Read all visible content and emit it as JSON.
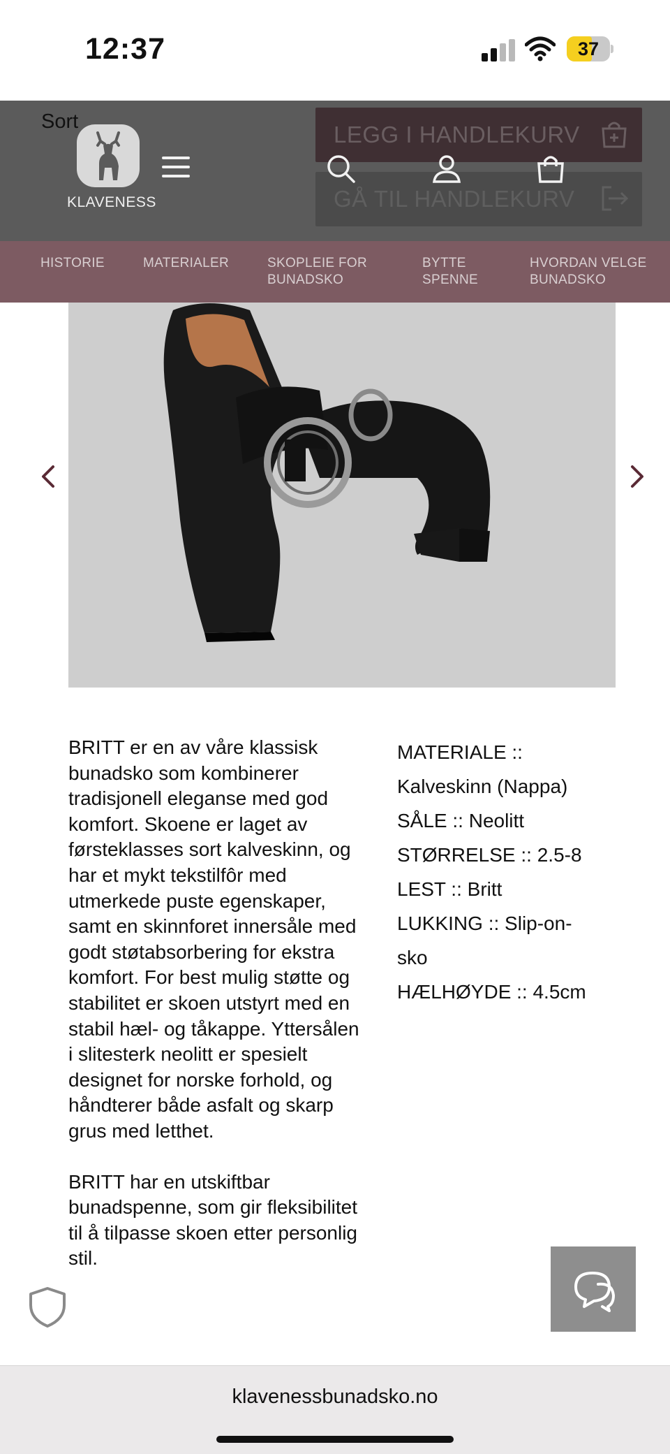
{
  "status_bar": {
    "time": "12:37",
    "battery_level": "37",
    "battery_color": "#f5cf1f"
  },
  "header": {
    "color_label": "Sort",
    "brand": "KLAVENESS",
    "add_to_cart_label": "LEGG I HANDLEKURV",
    "go_to_cart_label": "GÅ TIL HANDLEKURV",
    "icons": [
      "deer-logo-icon",
      "menu-icon",
      "search-icon",
      "user-icon",
      "shopping-bag-icon",
      "cart-add-icon",
      "logout-arrow-icon"
    ],
    "background_color": "#5b5b5b"
  },
  "nav": {
    "items": [
      {
        "label": "HISTORIE"
      },
      {
        "label": "MATERIALER"
      },
      {
        "label": "SKOPLEIE FOR BUNADSKO"
      },
      {
        "label": "BYTTE SPENNE"
      },
      {
        "label": "HVORDAN VELGE BUNADSKO"
      }
    ],
    "background_color": "#7d5b62"
  },
  "gallery": {
    "prev_icon": "chevron-left-icon",
    "next_icon": "chevron-right-icon",
    "arrow_color": "#5a2a35"
  },
  "description": {
    "paragraphs": [
      "BRITT er en av våre klassisk bunadsko som kombinerer tradisjonell eleganse med god komfort. Skoene er laget av førsteklasses sort kalveskinn, og har et mykt tekstilfôr med utmerkede puste egenskaper, samt en skinnforet innersåle med godt støtabsorbering for ekstra komfort. For best mulig støtte og stabilitet er skoen utstyrt med en stabil hæl- og tåkappe. Yttersålen i slitesterk neolitt er spesielt designet for norske forhold, og håndterer både asfalt og skarp grus med letthet.",
      "BRITT har en utskiftbar bunadspenne, som gir fleksibilitet til å tilpasse skoen etter personlig stil."
    ]
  },
  "specs": {
    "lines": [
      "MATERIALE ::",
      "Kalveskinn (Nappa)",
      "SÅLE :: Neolitt",
      "STØRRELSE :: 2.5-8",
      "LEST :: Britt",
      "LUKKING :: Slip-on-",
      "sko",
      "HÆLHØYDE :: 4.5cm"
    ]
  },
  "floating": {
    "privacy_icon": "shield-icon",
    "chat_icon": "chat-bubbles-icon"
  },
  "browser": {
    "url": "klavenessbunadsko.no"
  }
}
